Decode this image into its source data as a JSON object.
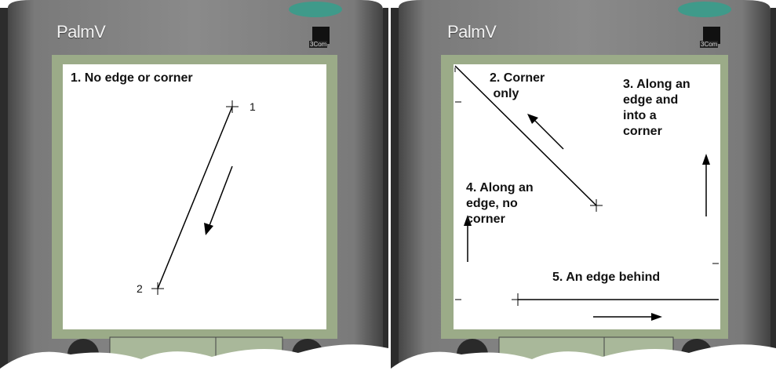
{
  "devices": [
    {
      "brand": "PalmV",
      "logo_text": "3Com",
      "screen_label": "1. No edge or corner",
      "point_labels": [
        "1",
        "2"
      ]
    },
    {
      "brand": "PalmV",
      "logo_text": "3Com",
      "labels": {
        "corner": "2. Corner\n only",
        "along_corner": "3. Along an\nedge and\ninto a\ncorner",
        "along_no_corner": "4. Along an\nedge, no\ncorner",
        "behind": "5. An edge behind"
      }
    }
  ],
  "colors": {
    "screen_bg": "#ffffff",
    "bezel": "#6a6a6a",
    "bezel_light": "#8c8c8c",
    "silk_green": "#a9b89a",
    "button_teal": "#3f9a8a"
  }
}
